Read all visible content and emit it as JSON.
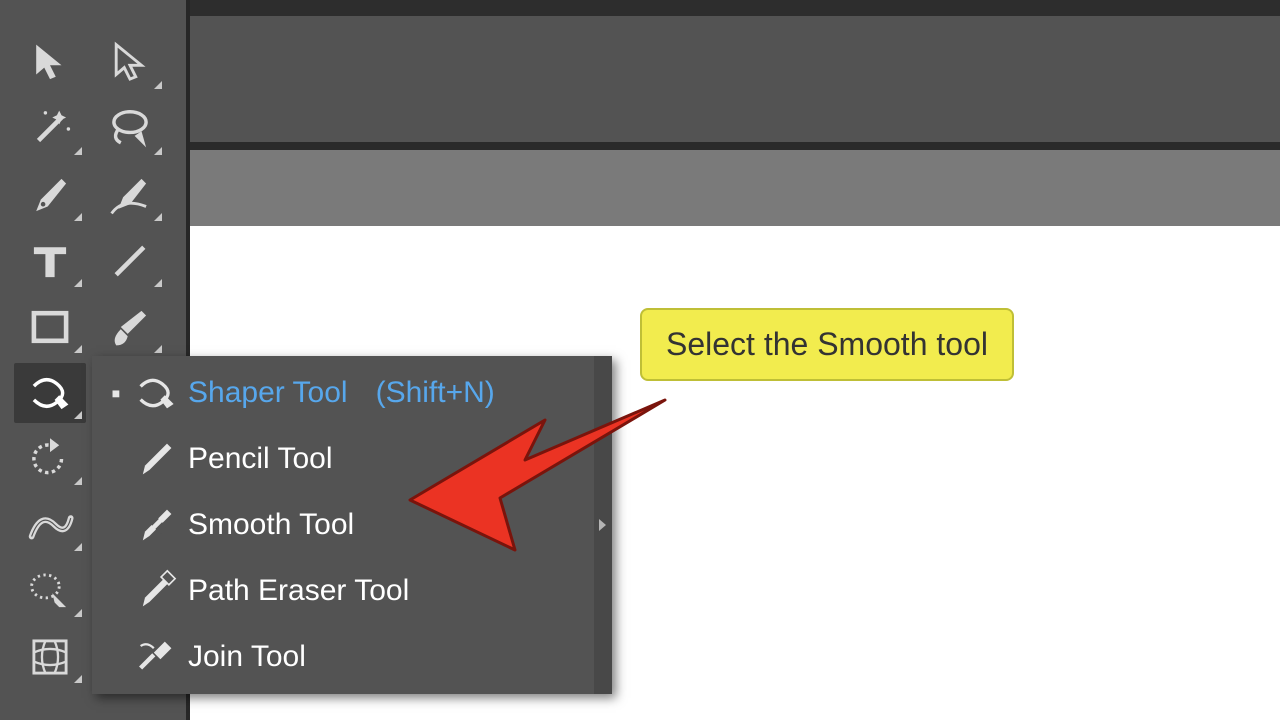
{
  "callout": {
    "text": "Select the Smooth tool"
  },
  "flyout": {
    "currentTool": "Shaper Tool",
    "items": [
      {
        "name": "Shaper Tool",
        "shortcut": "(Shift+N)",
        "current": true
      },
      {
        "name": "Pencil Tool",
        "shortcut": "",
        "current": false
      },
      {
        "name": "Smooth Tool",
        "shortcut": "",
        "current": false
      },
      {
        "name": "Path Eraser Tool",
        "shortcut": "",
        "current": false
      },
      {
        "name": "Join Tool",
        "shortcut": "",
        "current": false
      }
    ]
  },
  "colors": {
    "highlight": "#57a7ec",
    "arrow": "#eb3323",
    "callout": "#f2ec4e"
  }
}
